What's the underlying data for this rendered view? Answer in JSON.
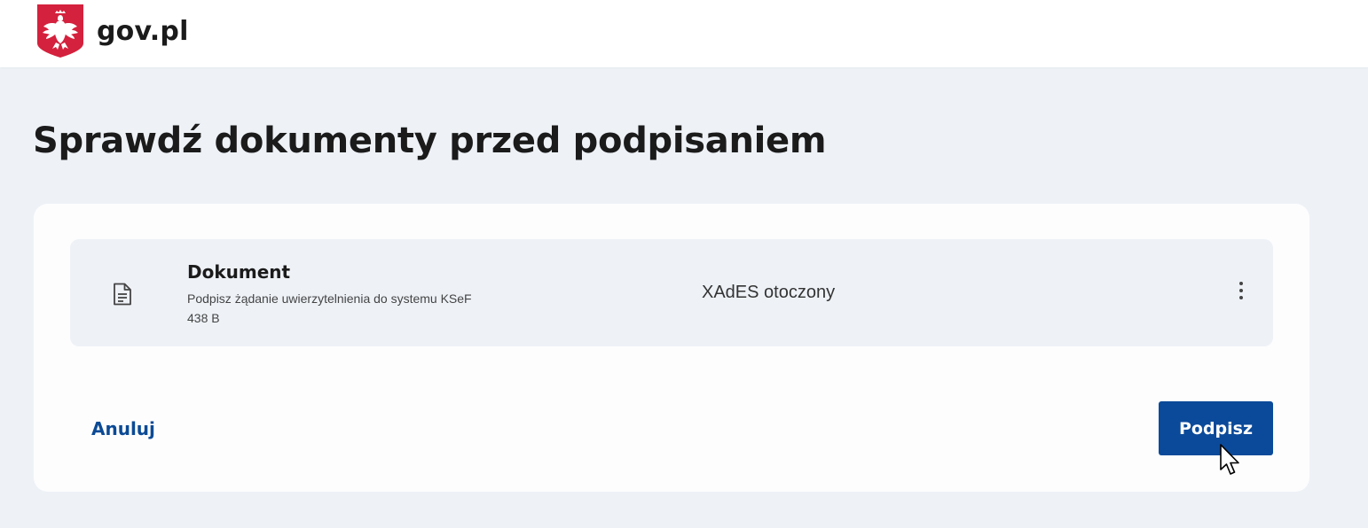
{
  "header": {
    "logo_text": "gov.pl",
    "emblem_icon": "polish-eagle-emblem",
    "brand_color": "#d4213d"
  },
  "main": {
    "title": "Sprawdź dokumenty przed podpisaniem"
  },
  "document": {
    "name": "Dokument",
    "description": "Podpisz żądanie uwierzytelnienia do systemu KSeF",
    "size": "438 B",
    "format": "XAdES otoczony",
    "file_icon": "document-icon",
    "menu_icon": "more-vertical-icon"
  },
  "actions": {
    "cancel_label": "Anuluj",
    "sign_label": "Podpisz",
    "primary_color": "#0b4a9a"
  }
}
